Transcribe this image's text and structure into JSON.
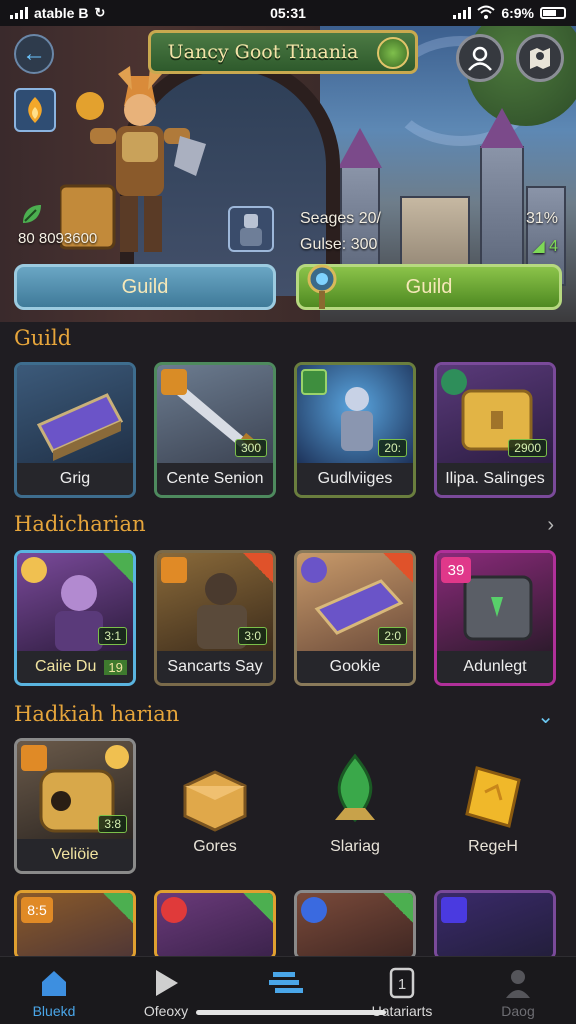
{
  "status_bar": {
    "carrier": "atable B",
    "time": "05:31",
    "battery": "6:9%"
  },
  "header": {
    "title": "Uancy Goot Tinania"
  },
  "hero": {
    "power_value": "80 8093600",
    "stats_line1_left": "Seages 20/",
    "stats_line1_right": "31%",
    "stats_line2_left": "Gulse: 300",
    "stats_line2_right": "4",
    "button_left": "Guild",
    "button_right": "Guild"
  },
  "sections": {
    "guild": {
      "title": "Guild",
      "cards": [
        {
          "label": "Grig",
          "value": ""
        },
        {
          "label": "Cente Senion",
          "value": "300"
        },
        {
          "label": "Gudlviiges",
          "value": "20:"
        },
        {
          "label": "Ilipa. Salinges",
          "value": "2900"
        }
      ]
    },
    "hadicharian": {
      "title": "Hadicharian",
      "cards": [
        {
          "label": "Caiie Du",
          "value": "3:1",
          "value2": "19"
        },
        {
          "label": "Sancarts Say",
          "value": "3:0"
        },
        {
          "label": "Gookie",
          "value": "2:0"
        },
        {
          "label": "Adunlegt",
          "value": "",
          "corner_number": "39"
        }
      ]
    },
    "hadkiah": {
      "title": "Hadkiah harian",
      "featured": {
        "label": "Veliöie",
        "value": "3:8"
      },
      "items": [
        {
          "label": "Gores"
        },
        {
          "label": "Slariag"
        },
        {
          "label": "RegeH"
        }
      ],
      "partial_row_corner": "8:5"
    }
  },
  "bottom_nav": [
    {
      "label": "Bluekd",
      "icon": "home-icon"
    },
    {
      "label": "Ofeoxy",
      "icon": "play-icon"
    },
    {
      "label": "",
      "icon": "stairs-icon"
    },
    {
      "label": "Uatariarts",
      "icon": "card-1-icon"
    },
    {
      "label": "Daog",
      "icon": "person-icon"
    }
  ],
  "colors": {
    "section_title": "#e6a53b",
    "accent_blue": "#4aa6e8",
    "accent_green": "#8bc34a",
    "background": "#1f1d22"
  }
}
